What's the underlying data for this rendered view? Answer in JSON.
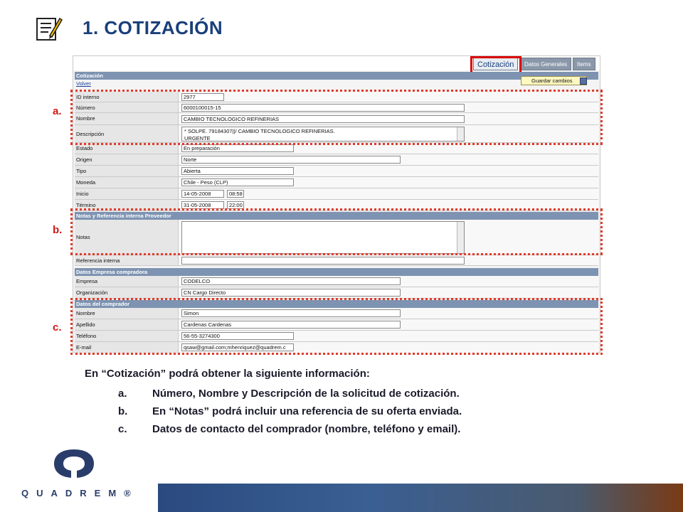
{
  "slide": {
    "title": "1. COTIZACIÓN"
  },
  "tabs": [
    {
      "label": "Cotización",
      "active": true
    },
    {
      "label": "Datos Generales",
      "active": false
    },
    {
      "label": "Items",
      "active": false
    }
  ],
  "form": {
    "header_title": "Cotización",
    "back_link": "Volver",
    "save_label": "Guardar cambios",
    "fields": {
      "id_interno": {
        "label": "ID interno",
        "value": "2977"
      },
      "numero": {
        "label": "Número",
        "value": "6000100015-15"
      },
      "nombre": {
        "label": "Nombre",
        "value": "CAMBIO TECNOLOGICO REFINERIAS"
      },
      "descripcion": {
        "label": "Descripción",
        "line1": "*    SOLPE. 79184307||/    CAMBIO TECNOLOGICO REFINERIAS.",
        "line2": "URGENTE"
      },
      "estado": {
        "label": "Estado",
        "value": "En preparación"
      },
      "origen": {
        "label": "Origen",
        "value": "Norte"
      },
      "tipo": {
        "label": "Tipo",
        "value": "Abierta"
      },
      "moneda": {
        "label": "Moneda",
        "value": "Chile - Peso (CLP)"
      },
      "inicio": {
        "label": "Inicio",
        "date": "14-05-2008",
        "time": "08:58"
      },
      "termino": {
        "label": "Término",
        "date": "31-05-2008",
        "time": "22:00"
      }
    },
    "notas_section": {
      "title": "Notas y Referencia interna Proveedor",
      "notas_label": "Notas",
      "referencia_label": "Referencia interna"
    },
    "empresa_section": {
      "title": "Datos Empresa compradora",
      "empresa_label": "Empresa",
      "empresa_value": "CODELCO",
      "organizacion_label": "Organización",
      "organizacion_value": "CN Cargo Directo"
    },
    "comprador_section": {
      "title": "Datos del comprador",
      "nombre_label": "Nombre",
      "nombre_value": "Simon",
      "apellido_label": "Apellido",
      "apellido_value": "Cardenas Cardenas",
      "telefono_label": "Teléfono",
      "telefono_value": "56-55-3274300",
      "email_label": "E-mail",
      "email_value": "qsaw@gmail.com;mhenriquez@quadrem.c"
    }
  },
  "markers": {
    "a": "a.",
    "b": "b.",
    "c": "c."
  },
  "description": {
    "intro": "En  “Cotización”  podrá obtener la siguiente información:",
    "items": [
      {
        "letter": "a.",
        "text": "Número, Nombre y Descripción de la solicitud de cotización."
      },
      {
        "letter": "b.",
        "text": "En “Notas” podrá incluir una referencia de su oferta enviada."
      },
      {
        "letter": "c.",
        "text": "Datos de contacto del comprador (nombre, teléfono y email)."
      }
    ]
  },
  "brand": {
    "logo_text": "QUADREM®"
  },
  "colors": {
    "title": "#1a3f7a",
    "highlight": "#d90000",
    "section_header": "#7d93b1"
  }
}
